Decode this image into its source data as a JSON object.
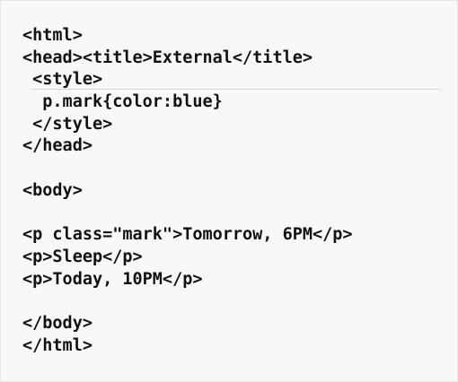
{
  "code_lines": [
    "<html>",
    "<head><title>External</title>",
    " <style>",
    "  p.mark{color:blue}",
    " </style>",
    "</head>",
    "",
    "<body>",
    "",
    "<p class=\"mark\">Tomorrow, 6PM</p>",
    "<p>Sleep</p>",
    "<p>Today, 10PM</p>",
    "",
    "</body>",
    "</html>"
  ]
}
